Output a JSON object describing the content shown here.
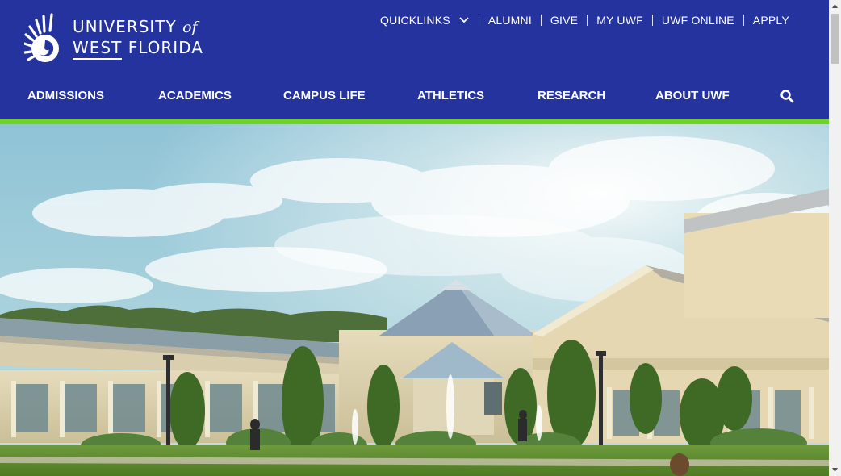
{
  "logo": {
    "line1": "UNIVERSITY",
    "line1_of": "of",
    "line2_first": "WEST",
    "line2_second": "FLORIDA",
    "icon": "nautilus-shell-icon"
  },
  "utility_nav": {
    "items": [
      {
        "label": "QUICKLINKS",
        "has_dropdown": true
      },
      {
        "label": "ALUMNI"
      },
      {
        "label": "GIVE"
      },
      {
        "label": "MY UWF"
      },
      {
        "label": "UWF ONLINE"
      },
      {
        "label": "APPLY"
      }
    ],
    "dropdown_icon": "chevron-down-icon"
  },
  "main_nav": {
    "items": [
      {
        "label": "ADMISSIONS"
      },
      {
        "label": "ACADEMICS"
      },
      {
        "label": "CAMPUS LIFE"
      },
      {
        "label": "ATHLETICS"
      },
      {
        "label": "RESEARCH"
      },
      {
        "label": "ABOUT UWF"
      }
    ],
    "search_icon": "search-icon"
  },
  "colors": {
    "brand_blue": "#24339d",
    "accent_green": "#6cd61c",
    "text_on_brand": "#ffffff"
  },
  "hero": {
    "content": "campus photo: pyramid-roof buildings, fountain, lawn, trees, blue sky with clouds"
  }
}
